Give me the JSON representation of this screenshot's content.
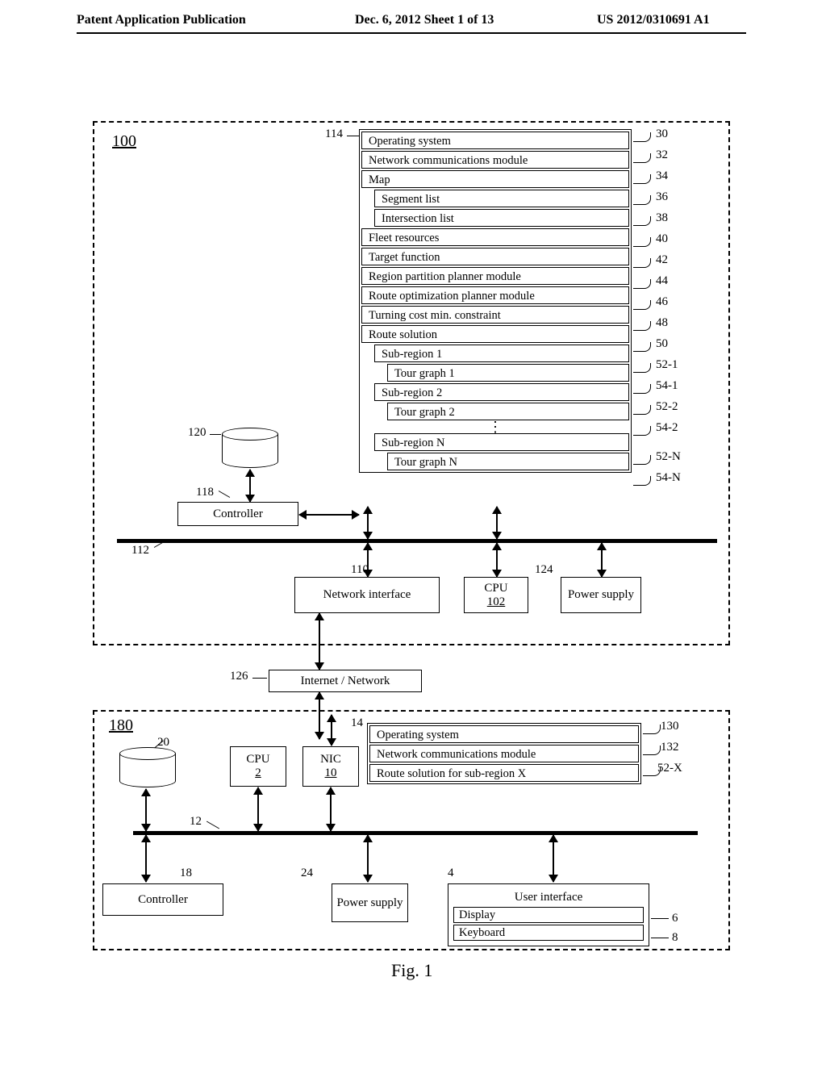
{
  "header": {
    "left": "Patent Application Publication",
    "center": "Dec. 6, 2012   Sheet 1 of 13",
    "right": "US 2012/0310691 A1"
  },
  "figure_caption": "Fig. 1",
  "box100": {
    "id_label": "100",
    "memory_ref": "114",
    "items": [
      {
        "text": "Operating system",
        "indent": 0,
        "ref": "30"
      },
      {
        "text": "Network communications module",
        "indent": 0,
        "ref": "32"
      },
      {
        "text": "Map",
        "indent": 0,
        "ref": "34"
      },
      {
        "text": "Segment list",
        "indent": 1,
        "ref": "36"
      },
      {
        "text": "Intersection list",
        "indent": 1,
        "ref": "38"
      },
      {
        "text": "Fleet resources",
        "indent": 0,
        "ref": "40"
      },
      {
        "text": "Target function",
        "indent": 0,
        "ref": "42"
      },
      {
        "text": "Region partition planner module",
        "indent": 0,
        "ref": "44"
      },
      {
        "text": "Route optimization planner module",
        "indent": 0,
        "ref": "46"
      },
      {
        "text": "Turning cost min. constraint",
        "indent": 0,
        "ref": "48"
      },
      {
        "text": "Route solution",
        "indent": 0,
        "ref": "50"
      },
      {
        "text": "Sub-region 1",
        "indent": 1,
        "ref": "52-1"
      },
      {
        "text": "Tour graph 1",
        "indent": 2,
        "ref": "54-1"
      },
      {
        "text": "Sub-region 2",
        "indent": 1,
        "ref": "52-2"
      },
      {
        "text": "Tour graph 2",
        "indent": 2,
        "ref": "54-2"
      },
      {
        "dots": true
      },
      {
        "text": "Sub-region N",
        "indent": 1,
        "ref": "52-N"
      },
      {
        "text": "Tour graph N",
        "indent": 2,
        "ref": "54-N"
      }
    ],
    "disk_ref": "120",
    "controller": {
      "label": "Controller",
      "ref": "118"
    },
    "bus_ref": "112",
    "network_interface": {
      "label": "Network interface",
      "ref": "110"
    },
    "cpu": {
      "label": "CPU",
      "under": "102"
    },
    "power": {
      "label": "Power supply",
      "ref": "124"
    }
  },
  "middle": {
    "internet_label": "Internet / Network",
    "internet_ref": "126"
  },
  "box180": {
    "id_label": "180",
    "memory_ref": "14",
    "items": [
      {
        "text": "Operating system",
        "ref": "130"
      },
      {
        "text": "Network communications module",
        "ref": "132"
      },
      {
        "text": "Route solution for sub-region X",
        "ref": "52-X"
      }
    ],
    "disk_ref": "20",
    "cpu": {
      "label": "CPU",
      "under": "2"
    },
    "nic": {
      "label": "NIC",
      "under": "10"
    },
    "bus_ref": "12",
    "controller": {
      "label": "Controller",
      "ref": "18"
    },
    "power": {
      "label": "Power supply",
      "ref": "24"
    },
    "ui_ref": "4",
    "ui": {
      "label": "User interface"
    },
    "display": {
      "label": "Display",
      "ref": "6"
    },
    "keyboard": {
      "label": "Keyboard",
      "ref": "8"
    }
  }
}
